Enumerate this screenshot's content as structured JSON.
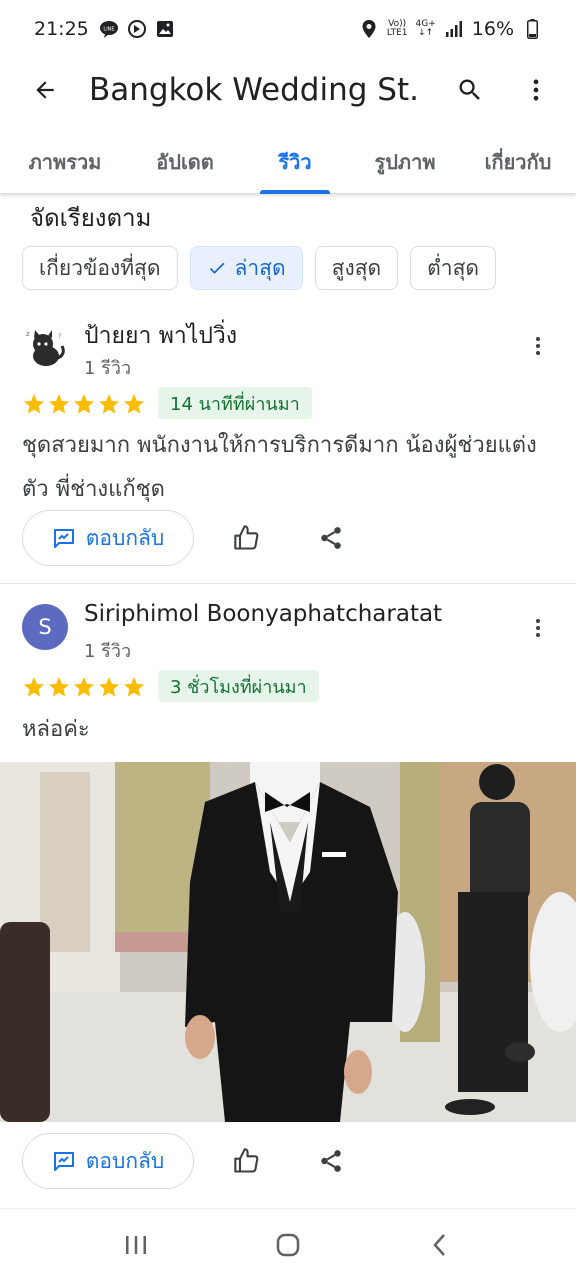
{
  "status": {
    "time": "21:25",
    "battery": "16%",
    "network": "4G+",
    "volte_top": "Vo))",
    "volte_bottom": "LTE1"
  },
  "appbar": {
    "title": "Bangkok Wedding St..."
  },
  "tabs": [
    {
      "label": "ภาพรวม",
      "active": false
    },
    {
      "label": "อัปเดต",
      "active": false
    },
    {
      "label": "รีวิว",
      "active": true
    },
    {
      "label": "รูปภาพ",
      "active": false
    },
    {
      "label": "เกี่ยวกับ",
      "active": false
    }
  ],
  "sort": {
    "label": "จัดเรียงตาม",
    "chips": [
      {
        "label": "เกี่ยวข้องที่สุด",
        "selected": false
      },
      {
        "label": "ล่าสุด",
        "selected": true
      },
      {
        "label": "สูงสุด",
        "selected": false
      },
      {
        "label": "ต่ำสุด",
        "selected": false
      }
    ]
  },
  "reviews": [
    {
      "name": "ป้ายยา พาไปวิ่ง",
      "count": "1 รีวิว",
      "rating": 5,
      "time": "14 นาทีที่ผ่านมา",
      "text": "ชุดสวยมาก พนักงานให้การบริการดีมาก น้องผู้ช่วยแต่งตัว พี่ช่างแก้ชุด",
      "reply_label": "ตอบกลับ"
    },
    {
      "name": "Siriphimol Boonyaphatcharatat",
      "avatar_letter": "S",
      "count": "1 รีวิว",
      "rating": 5,
      "time": "3 ชั่วโมงที่ผ่านมา",
      "text": "หล่อค่ะ",
      "reply_label": "ตอบกลับ"
    }
  ],
  "colors": {
    "accent": "#1a73e8",
    "star": "#fbbc04",
    "badge_bg": "#e6f4ea",
    "badge_text": "#137333",
    "avatar_s": "#5c6bc0"
  }
}
